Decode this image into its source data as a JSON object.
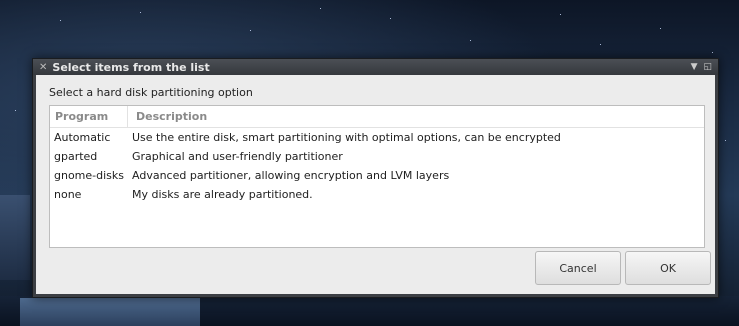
{
  "window": {
    "title": "Select items from the list",
    "close_icon": "close-icon",
    "menu_icon": "dropdown-arrow-icon",
    "maximize_icon": "maximize-icon"
  },
  "prompt": "Select a hard disk partitioning option",
  "list": {
    "columns": [
      "Program",
      "Description"
    ],
    "rows": [
      {
        "program": "Automatic",
        "description": "Use the entire disk, smart partitioning with optimal options, can be encrypted"
      },
      {
        "program": "gparted",
        "description": "Graphical and user-friendly partitioner"
      },
      {
        "program": "gnome-disks",
        "description": "Advanced partitioner, allowing encryption and LVM layers"
      },
      {
        "program": "none",
        "description": "My disks are already partitioned."
      }
    ]
  },
  "buttons": {
    "cancel": "Cancel",
    "ok": "OK"
  }
}
